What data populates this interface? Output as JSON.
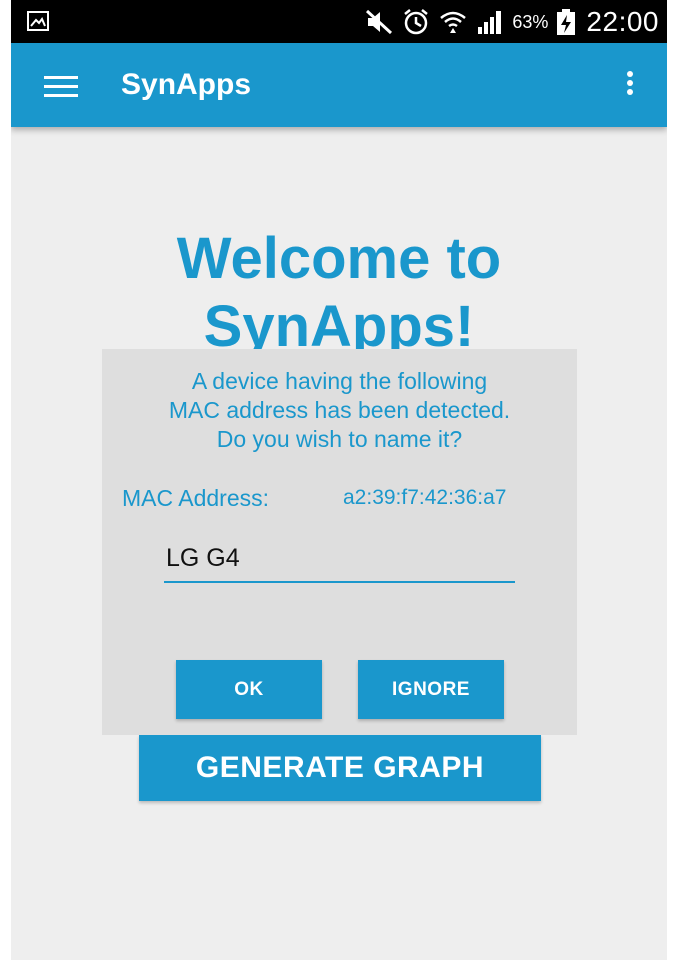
{
  "status_bar": {
    "icons": [
      "gallery-notification-icon",
      "mute-icon",
      "alarm-icon",
      "wifi-icon",
      "signal-icon",
      "battery-charging-icon"
    ],
    "battery_percent": "63%",
    "time": "22:00"
  },
  "app_bar": {
    "title": "SynApps",
    "menu_icon": "hamburger-menu-icon",
    "overflow_icon": "more-vert-icon"
  },
  "welcome": {
    "line1": "Welcome to",
    "line2": "SynApps!"
  },
  "dialog": {
    "message_line1": "A device having the following",
    "message_line2": "MAC address has been detected.",
    "message_line3": "Do you wish to name it?",
    "mac_label": "MAC Address:",
    "mac_value": "a2:39:f7:42:36:a7",
    "name_value": "LG G4",
    "ok_label": "OK",
    "ignore_label": "IGNORE"
  },
  "main": {
    "generate_label": "GENERATE GRAPH"
  },
  "colors": {
    "primary": "#1a97cc",
    "background": "#eeeeee",
    "dialog_background": "#dedede",
    "status_bar": "#000000"
  }
}
